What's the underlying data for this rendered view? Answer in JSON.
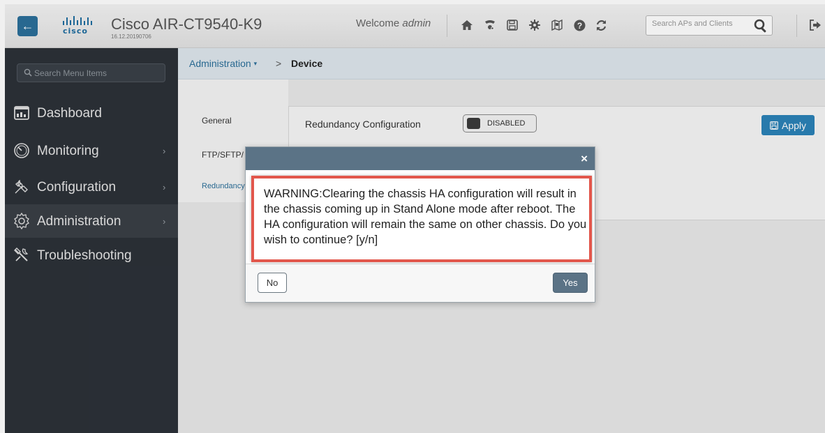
{
  "header": {
    "logo_text": "cisco",
    "title": "Cisco AIR-CT9540-K9",
    "version": "16.12.20190706",
    "welcome_prefix": "Welcome ",
    "welcome_user": "admin",
    "icons": [
      "home-icon",
      "wireless-icon",
      "save-icon",
      "gear-icon",
      "map-icon",
      "help-icon",
      "refresh-icon",
      "logout-icon"
    ],
    "search_placeholder": "Search APs and Clients"
  },
  "sidebar": {
    "search_placeholder": "Search Menu Items",
    "items": [
      {
        "label": "Dashboard",
        "icon": "dashboard-icon",
        "has_chevron": false
      },
      {
        "label": "Monitoring",
        "icon": "monitoring-icon",
        "has_chevron": true
      },
      {
        "label": "Configuration",
        "icon": "configuration-icon",
        "has_chevron": true
      },
      {
        "label": "Administration",
        "icon": "administration-icon",
        "has_chevron": true,
        "active": true
      },
      {
        "label": "Troubleshooting",
        "icon": "troubleshooting-icon",
        "has_chevron": false
      }
    ]
  },
  "breadcrumb": {
    "parent": "Administration",
    "arrow": ">",
    "current": "Device"
  },
  "tabs": [
    "General",
    "FTP/SFTP/",
    "Redundancy"
  ],
  "redundancy": {
    "label": "Redundancy Configuration",
    "toggle_state": "DISABLED",
    "apply_label": "Apply"
  },
  "modal": {
    "close": "×",
    "message": "WARNING:Clearing the chassis HA configuration will result in the chassis coming up in Stand Alone mode after reboot. The HA configuration will remain the same on other chassis. Do you wish to continue? [y/n]",
    "no_label": "No",
    "yes_label": "Yes"
  },
  "colors": {
    "brand_blue": "#2b6f9a",
    "sidebar_bg": "#2c3138",
    "modal_header": "#5b7386",
    "highlight_red": "#e2574c"
  }
}
